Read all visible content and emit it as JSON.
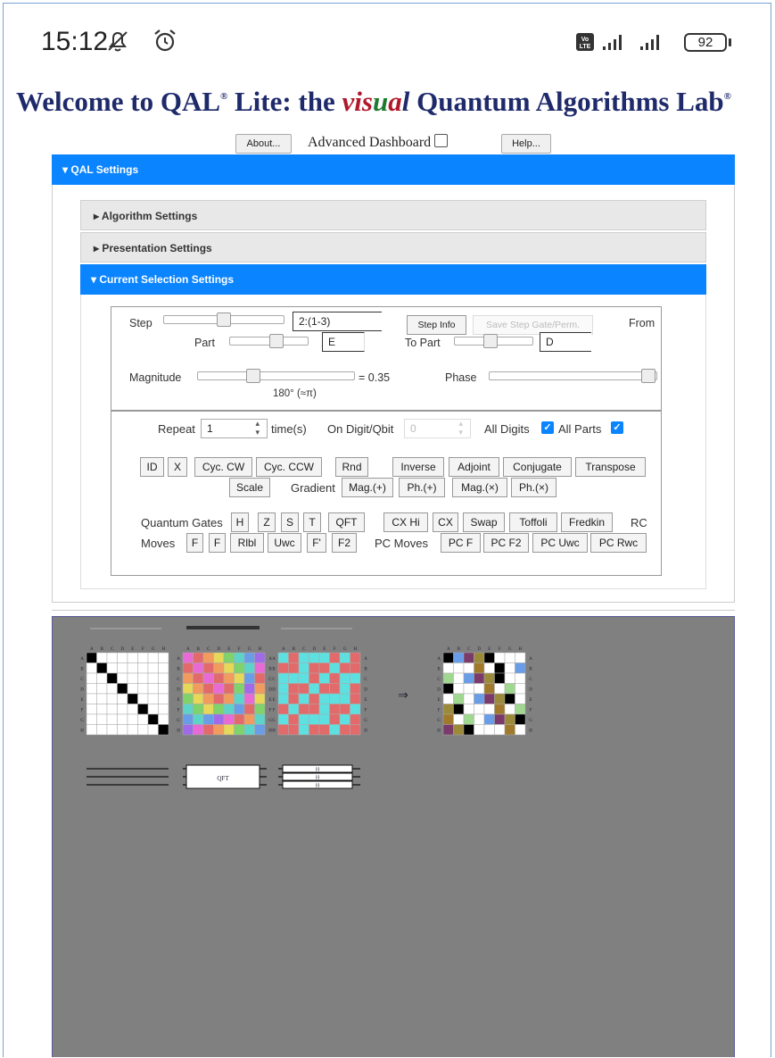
{
  "status": {
    "time": "15:12",
    "battery": "92",
    "mute_icon": "bell-off-icon",
    "alarm_icon": "alarm-icon",
    "network": "volte-icon"
  },
  "title": {
    "part1": "Welcome to QAL",
    "reg1": "®",
    "part2": " Lite: the ",
    "vis": [
      "v",
      "i",
      "s",
      "u",
      "a",
      "l"
    ],
    "part3": " Quantum Algorithms Lab",
    "reg2": "®"
  },
  "toolbar": {
    "about": "About...",
    "advanced": "Advanced Dashboard",
    "help": "Help..."
  },
  "sections": {
    "qal": "QAL Settings",
    "algorithm": "Algorithm Settings",
    "presentation": "Presentation Settings",
    "current": "Current Selection Settings"
  },
  "step": {
    "label": "Step",
    "value": "2:(1-3)",
    "info": "Step Info",
    "save": "Save Step Gate/Perm.",
    "from": "From"
  },
  "part": {
    "label": "Part",
    "value": "E",
    "to_label": "To Part",
    "to_value": "D"
  },
  "magnitude": {
    "label": "Magnitude",
    "value": "= 0.35",
    "phase_label": "Phase",
    "phase_value": "180° (≈π)"
  },
  "repeat": {
    "label": "Repeat",
    "value": "1",
    "times": "time(s)",
    "digit_label": "On Digit/Qbit",
    "digit_value": "0",
    "all_digits": "All Digits",
    "all_parts": "All Parts"
  },
  "ops_row1": [
    "ID",
    "X",
    "Cyc. CW",
    "Cyc. CCW",
    "Rnd",
    "Inverse",
    "Adjoint",
    "Conjugate",
    "Transpose"
  ],
  "ops_row2": {
    "scale": "Scale",
    "gradient": "Gradient",
    "buttons": [
      "Mag.(+)",
      "Ph.(+)",
      "Mag.(×)",
      "Ph.(×)"
    ]
  },
  "gates": {
    "label": "Quantum Gates",
    "buttons": [
      "H",
      "Z",
      "S",
      "T",
      "QFT",
      "CX Hi",
      "CX",
      "Swap",
      "Toffoli",
      "Fredkin"
    ],
    "rc": "RC"
  },
  "moves": {
    "label": "Moves",
    "buttons": [
      "F",
      "F",
      "Rlbl",
      "Uwc",
      "F'",
      "F2"
    ],
    "pc_label": "PC Moves",
    "pc_buttons": [
      "PC F",
      "PC F2",
      "PC Uwc",
      "PC Rwc"
    ]
  },
  "matrix_labels": [
    "A",
    "B",
    "C",
    "D",
    "E",
    "F",
    "G",
    "H"
  ],
  "circuit": {
    "qft": "QFT",
    "h": "H"
  }
}
